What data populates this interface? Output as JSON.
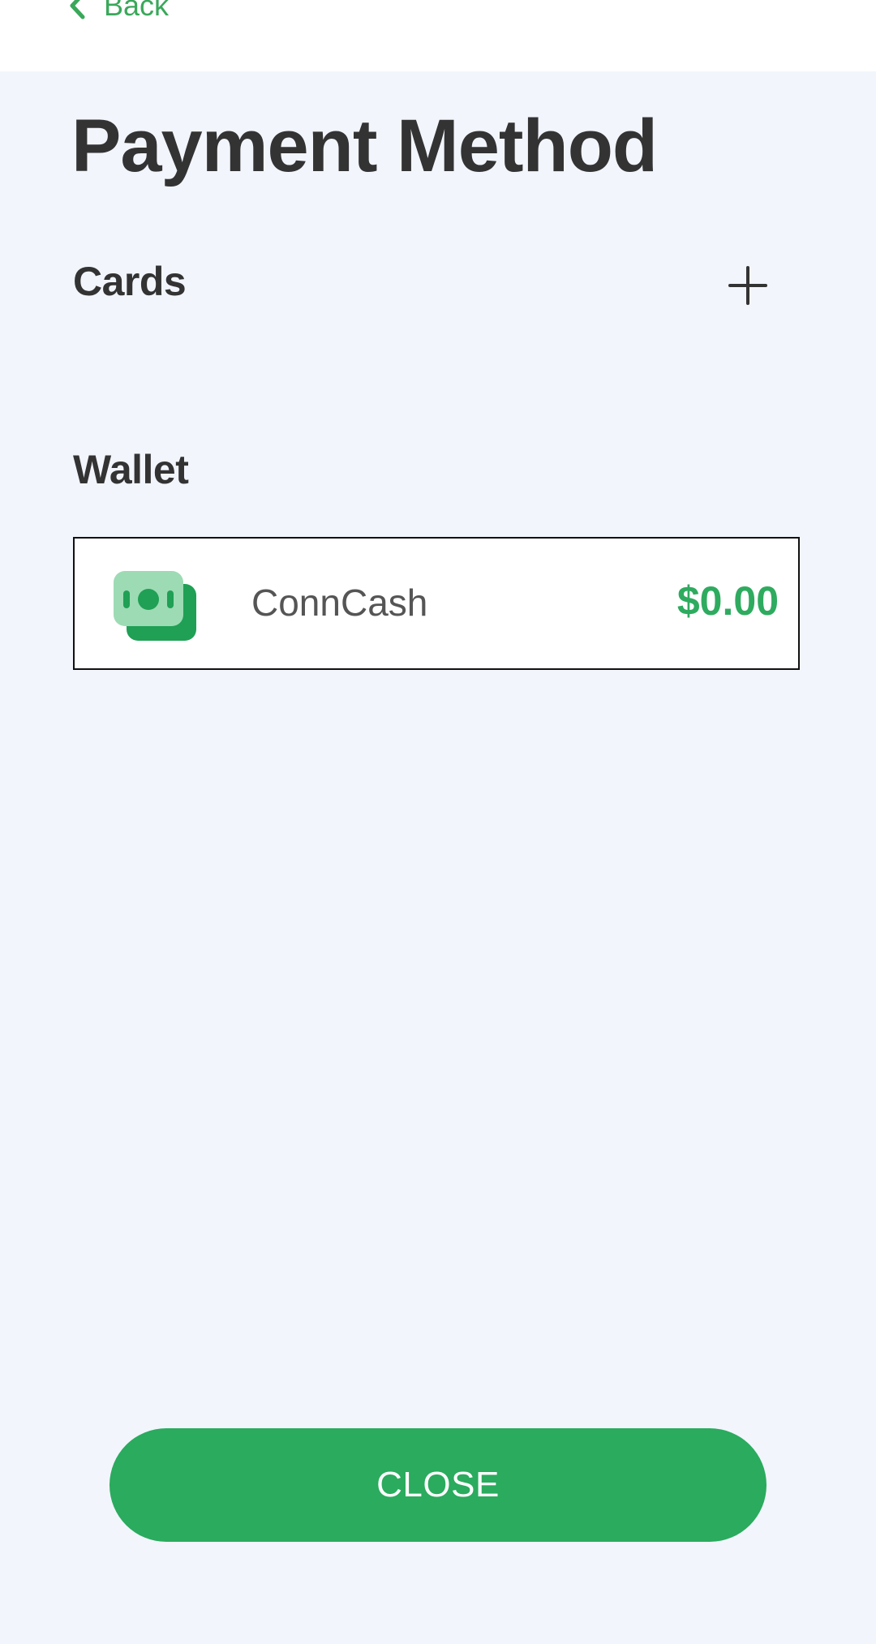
{
  "header": {
    "back_label": "Back",
    "back_icon": "chevron-left-icon"
  },
  "page": {
    "title": "Payment Method"
  },
  "cards": {
    "title": "Cards",
    "add_icon": "plus-icon"
  },
  "wallet": {
    "title": "Wallet",
    "items": [
      {
        "name": "ConnCash",
        "balance": "$0.00",
        "icon": "cash-icon"
      }
    ]
  },
  "footer": {
    "close_label": "CLOSE"
  },
  "colors": {
    "accent": "#2aab5e",
    "background": "#f2f5fc",
    "text": "#333333"
  }
}
